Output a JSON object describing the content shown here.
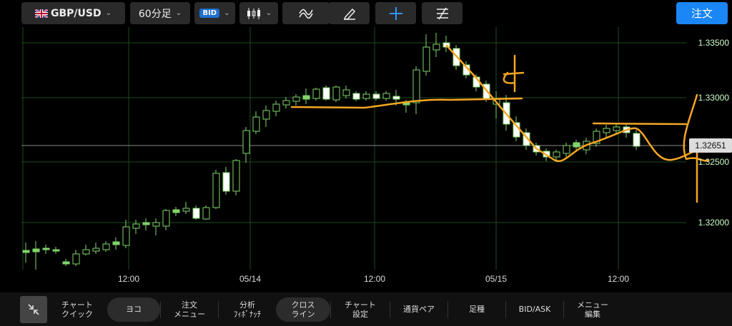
{
  "toolbar": {
    "pair": "GBP/USD",
    "timeframe": "60分足",
    "price_type": "BID",
    "order_button": "注文"
  },
  "chart": {
    "price_labels": [
      "1.33500",
      "1.33000",
      "1.32500",
      "1.32000"
    ],
    "current_price": "1.32651",
    "time_labels": [
      "12:00",
      "05/14",
      "12:00",
      "05/15",
      "12:00"
    ],
    "colors": {
      "background": "#000000",
      "grid": "#1f4a1f",
      "bull": "#ffffff",
      "border": "#7fd66a",
      "annotation": "#f5a623"
    }
  },
  "bottom_bar": {
    "items": [
      "チャート\nクイック",
      "ヨコ",
      "注文\nメニュー",
      "分析\nﾌｨﾎﾞﾅｯﾁ",
      "クロス\nライン",
      "チャート\n設定",
      "通貨ペア",
      "足種",
      "BID/ASK",
      "メニュー\n編集"
    ]
  }
}
